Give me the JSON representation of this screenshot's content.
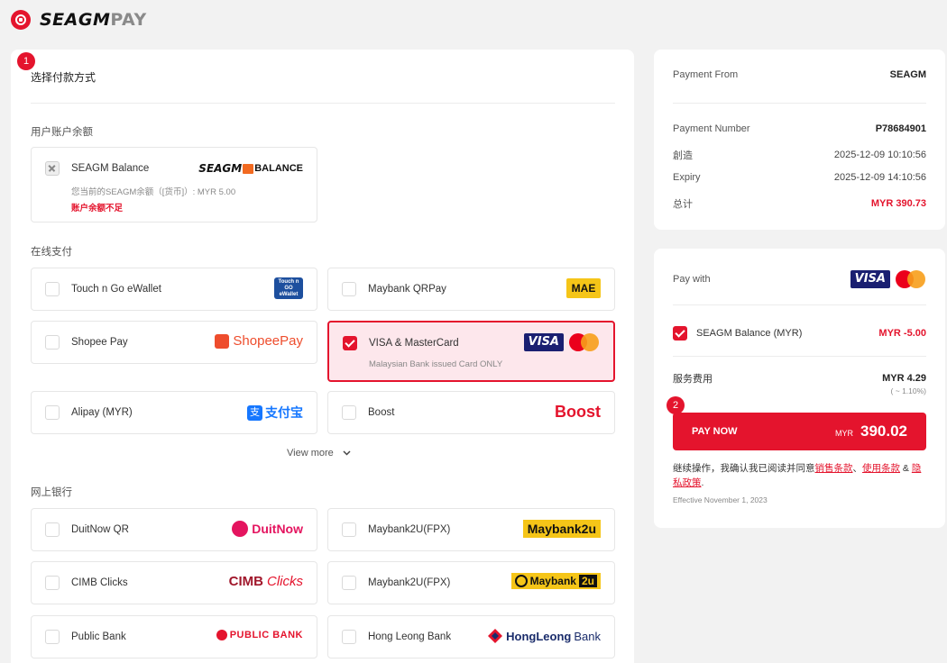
{
  "header": {
    "brand_main": "SEAGM",
    "brand_sub": "PAY"
  },
  "left": {
    "step": "1",
    "title": "选择付款方式",
    "sections": {
      "balance": "用户账户余额",
      "online": "在线支付",
      "bank": "网上银行"
    },
    "balance_card": {
      "label": "SEAGM Balance",
      "logo_text_a": "SEAGM",
      "logo_text_b": "BALANCE",
      "sub": "您当前的SEAGM余额（[货币]）: MYR 5.00",
      "warn": "账户余额不足"
    },
    "methods": {
      "tng": {
        "label": "Touch n Go eWallet",
        "logo": "Touch n GO eWallet"
      },
      "maybank_qr": {
        "label": "Maybank QRPay",
        "logo": "MAE"
      },
      "shopee": {
        "label": "Shopee Pay",
        "logo": "ShopeePay"
      },
      "visa": {
        "label": "VISA & MasterCard",
        "sub": "Malaysian Bank issued Card ONLY",
        "logo": "VISA"
      },
      "alipay": {
        "label": "Alipay (MYR)",
        "logo": "支付宝"
      },
      "boost": {
        "label": "Boost",
        "logo": "Boost"
      }
    },
    "view_more": "View more",
    "banks": {
      "duitnow": {
        "label": "DuitNow QR",
        "logo": "DuitNow"
      },
      "m2u_1": {
        "label": "Maybank2U(FPX)",
        "logo": "Maybank2u"
      },
      "cimb": {
        "label": "CIMB Clicks",
        "logo_a": "CIMB",
        "logo_b": "Clicks"
      },
      "m2u_2": {
        "label": "Maybank2U(FPX)",
        "logo": "Maybank",
        "logo_b": "2u"
      },
      "public": {
        "label": "Public Bank",
        "logo": "PUBLIC BANK"
      },
      "hlb": {
        "label": "Hong Leong Bank",
        "logo_a": "HongLeong",
        "logo_b": "Bank"
      }
    }
  },
  "summary": {
    "payment_from_label": "Payment From",
    "payment_from_value": "SEAGM",
    "payment_number_label": "Payment Number",
    "payment_number_value": "P78684901",
    "created_label": "創造",
    "created_value": "2025-12-09 10:10:56",
    "expiry_label": "Expiry",
    "expiry_value": "2025-12-09 14:10:56",
    "total_label": "总计",
    "total_value": "MYR 390.73"
  },
  "pay": {
    "pay_with_label": "Pay with",
    "pay_with_logo": "VISA",
    "balance_label": "SEAGM Balance (MYR)",
    "balance_value": "MYR -5.00",
    "fee_label": "服务费用",
    "fee_value": "MYR 4.29",
    "fee_pct": "( ~ 1.10%)",
    "step": "2",
    "button_label": "PAY NOW",
    "button_currency": "MYR",
    "button_amount": "390.02",
    "terms_prefix": "继续操作，我确认我已阅读并同意",
    "terms_sales": "销售条款",
    "terms_sep": "、",
    "terms_use": "使用条款",
    "terms_amp": " & ",
    "terms_privacy": "隐私政策",
    "terms_end": ".",
    "effective": "Effective November 1, 2023"
  },
  "colors": {
    "accent": "#e4142d",
    "visa_blue": "#1a1f71"
  }
}
